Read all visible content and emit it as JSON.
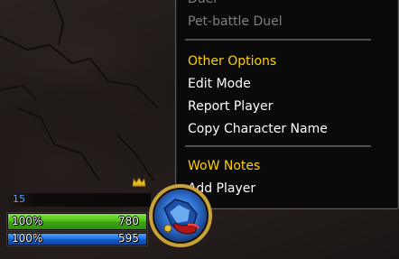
{
  "menu": {
    "items": [
      {
        "label": "Duel",
        "style": "disabled"
      },
      {
        "label": "Pet-battle Duel",
        "style": "disabled"
      },
      {
        "label": "Other Options",
        "style": "header"
      },
      {
        "label": "Edit Mode",
        "style": "normal"
      },
      {
        "label": "Report Player",
        "style": "normal"
      },
      {
        "label": "Copy Character Name",
        "style": "normal"
      },
      {
        "label": "WoW Notes",
        "style": "header"
      },
      {
        "label": "Add Player",
        "style": "normal"
      }
    ]
  },
  "unit_frame": {
    "level": "15",
    "health_percent_text": "100%",
    "health_value": "780",
    "health_fraction": 1.0,
    "mana_percent_text": "100%",
    "mana_value": "595",
    "mana_fraction": 1.0,
    "leader_icon": "crown-icon",
    "portrait_icon": "class-portrait-icon"
  },
  "colors": {
    "header": "#ffd100",
    "disabled": "#7f7f7f",
    "level": "#4da3ff",
    "health": "#4fc21a",
    "mana": "#1f74e6"
  }
}
